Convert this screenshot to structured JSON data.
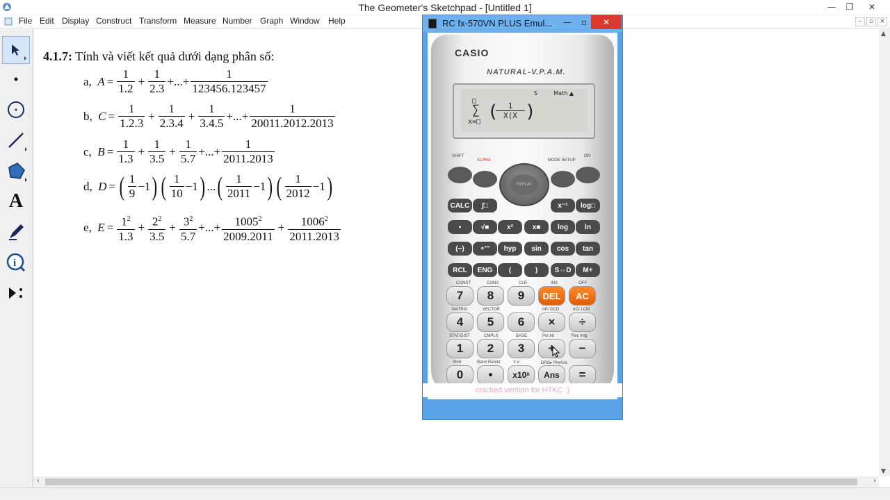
{
  "window": {
    "title": "The Geometer's Sketchpad - [Untitled 1]"
  },
  "menu": [
    "File",
    "Edit",
    "Display",
    "Construct",
    "Transform",
    "Measure",
    "Number",
    "Graph",
    "Window",
    "Help"
  ],
  "tools": [
    {
      "name": "arrow-tool-icon"
    },
    {
      "name": "point-tool-icon"
    },
    {
      "name": "compass-tool-icon"
    },
    {
      "name": "straightedge-tool-icon"
    },
    {
      "name": "polygon-tool-icon"
    },
    {
      "name": "text-tool-icon",
      "glyph": "A"
    },
    {
      "name": "marker-tool-icon"
    },
    {
      "name": "information-tool-icon"
    },
    {
      "name": "custom-tool-icon"
    }
  ],
  "content": {
    "heading_num": "4.1.7:",
    "heading_text": " Tính và viết kết quả dưới dạng phân số:",
    "a": {
      "label": "a,",
      "var": "A",
      "eq": "=",
      "n1": "1",
      "d1": "1.2",
      "n2": "1",
      "d2": "2.3",
      "dots": "+...+",
      "n3": "1",
      "d3": "123456.123457",
      "plus": "+"
    },
    "b": {
      "label": "b,",
      "var": "C",
      "eq": "=",
      "n1": "1",
      "d1": "1.2.3",
      "n2": "1",
      "d2": "2.3.4",
      "n3": "1",
      "d3": "3.4.5",
      "dots": "+...+",
      "n4": "1",
      "d4": "20011.2012.2013",
      "plus": "+"
    },
    "c": {
      "label": "c,",
      "var": "B",
      "eq": "=",
      "n1": "1",
      "d1": "1.3",
      "n2": "1",
      "d2": "3.5",
      "n3": "1",
      "d3": "5.7",
      "dots": "+...+",
      "n4": "1",
      "d4": "2011.2013",
      "plus": "+"
    },
    "d": {
      "label": "d,",
      "var": "D",
      "eq": "=",
      "n1": "1",
      "d1": "9",
      "n2": "1",
      "d2": "10",
      "n3": "1",
      "d3": "2011",
      "n4": "1",
      "d4": "2012",
      "minus": "−1",
      "dots": "..."
    },
    "e": {
      "label": "e,",
      "var": "E",
      "eq": "=",
      "n1": "1",
      "s1": "2",
      "d1": "1.3",
      "n2": "2",
      "s2": "2",
      "d2": "3.5",
      "n3": "3",
      "s3": "2",
      "d3": "5.7",
      "dots": "+...+",
      "n4": "1005",
      "s4": "2",
      "d4": "2009.2011",
      "n5": "1006",
      "s5": "2",
      "d5": "2011.2013",
      "plus": "+"
    }
  },
  "calculator": {
    "window_title": "RC fx-570VN PLUS Emul...",
    "brand": "CASIO",
    "model": "NATURAL-V.P.A.M.",
    "lcd_s": "S",
    "lcd_mode": "Math ▲",
    "lcd_sum": "∑",
    "lcd_top": "□",
    "lcd_bottom": "x=□",
    "lcd_num": "1",
    "lcd_den": "X(X",
    "dpad": "REPLAY",
    "row_labels": {
      "shift": "SHIFT",
      "alpha": "ALPHA",
      "mode": "MODE SETUP",
      "on": "ON"
    },
    "fkeys1": [
      "CALC",
      "∫□",
      "x⁻¹",
      "log□"
    ],
    "fkeys2": [
      "▪",
      "√■",
      "x²",
      "x■",
      "log",
      "ln"
    ],
    "fkeys3": [
      "(−)",
      "∘'''",
      "hyp",
      "sin",
      "cos",
      "tan"
    ],
    "fkeys4": [
      "RCL",
      "ENG",
      "(",
      ")",
      "S⇔D",
      "M+"
    ],
    "nkeys1": [
      "7",
      "8",
      "9",
      "DEL",
      "AC"
    ],
    "nkeys2": [
      "4",
      "5",
      "6",
      "×",
      "÷"
    ],
    "nkeys3": [
      "1",
      "2",
      "3",
      "+",
      "−"
    ],
    "nkeys4": [
      "0",
      "•",
      "x10ˣ",
      "Ans",
      "="
    ],
    "labels_top": [
      "CONST",
      "CONV",
      "CLR",
      "INS",
      "OFF"
    ],
    "labels_mid": [
      "MATRIX",
      "VECTOR",
      "nPr GCD",
      "nCr LCM"
    ],
    "labels_low": [
      "STAT/DIST",
      "CMPLX",
      "BASE",
      "Pol Int",
      "Rec Intg"
    ],
    "labels_bot": [
      "Rnd",
      "Ran# RanInt",
      "π e",
      "DRG▸ PreAns"
    ],
    "footer": "cracked version for HTKC :)"
  }
}
